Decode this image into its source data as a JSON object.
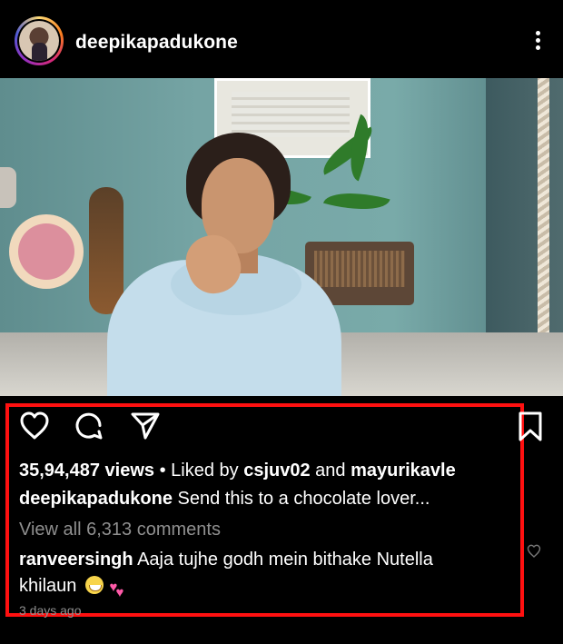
{
  "header": {
    "username": "deepikapadukone",
    "more_icon": "more-vertical-icon"
  },
  "post": {
    "actions": {
      "like_icon": "heart-icon",
      "comment_icon": "comment-icon",
      "share_icon": "share-icon",
      "save_icon": "bookmark-icon"
    },
    "views_count": "35,94,487 views",
    "liked_by_prefix": "Liked by",
    "liked_by_user1": "csjuv02",
    "liked_by_and": "and",
    "liked_by_user2": "mayurikavle",
    "caption_user": "deepikapadukone",
    "caption_text": "Send this to a chocolate lover...",
    "view_comments": "View all 6,313 comments",
    "top_comment_user": "ranveersingh",
    "top_comment_text_1": "Aaja tujhe godh mein bithake Nutella",
    "top_comment_text_2": "khilaun",
    "emoji_1": "grinning-face",
    "emoji_2": "two-hearts",
    "timestamp": "3 days ago"
  },
  "colors": {
    "highlight": "#ff1010",
    "secondary_text": "#8f8f8f"
  }
}
